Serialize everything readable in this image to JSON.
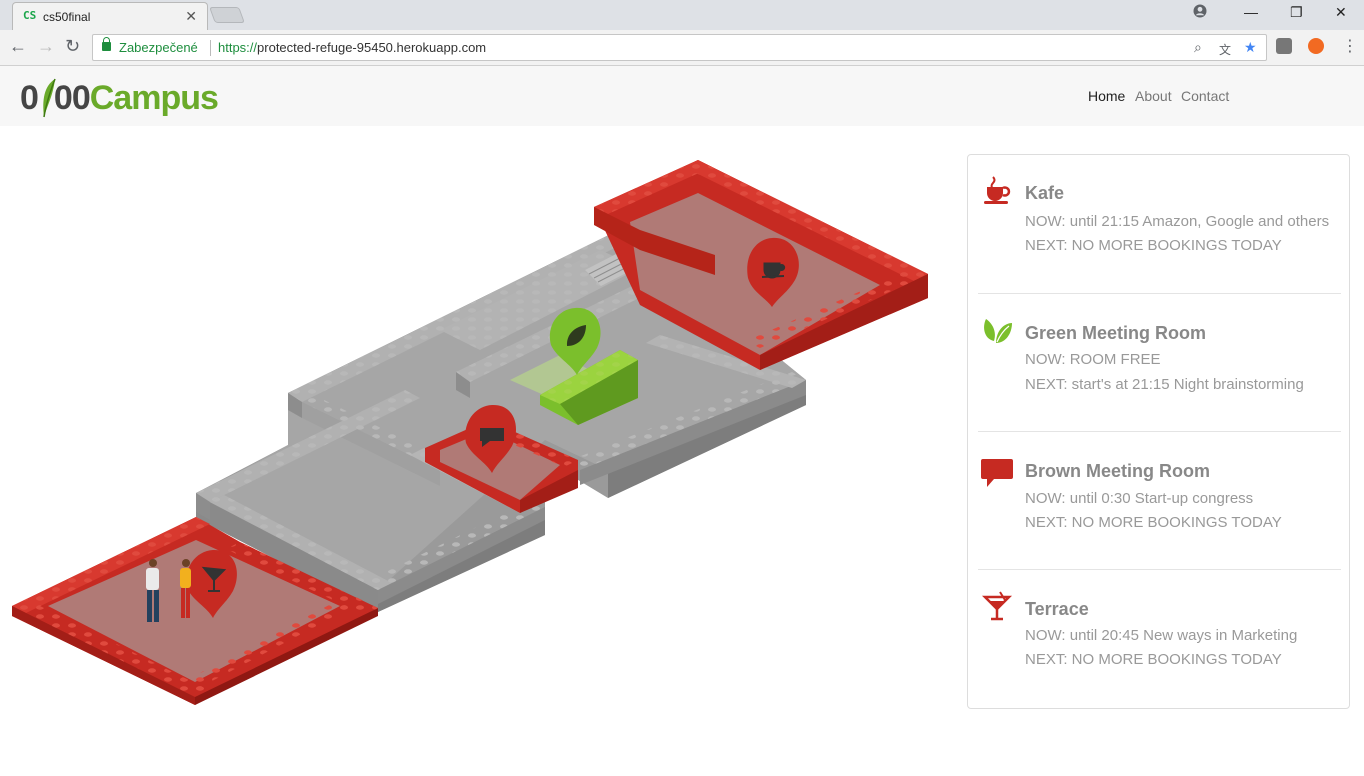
{
  "browser": {
    "tab_title": "cs50final",
    "tab_favicon": "CS",
    "secure_label": "Zabezpečené",
    "url_scheme": "https://",
    "url_rest": "protected-refuge-95450.herokuapp.com"
  },
  "site": {
    "logo_part1": "0",
    "logo_part2": "00",
    "logo_part3": "Campus",
    "nav": [
      "Home",
      "About",
      "Contact"
    ],
    "accent_green": "#6aaa2a",
    "accent_red": "#c62a22"
  },
  "rooms": [
    {
      "icon": "coffee-cup-icon",
      "name": "Kafe",
      "now": "NOW: until 21:15 Amazon, Google and others",
      "next": "NEXT: NO MORE BOOKINGS TODAY",
      "color": "#c62a22"
    },
    {
      "icon": "leaf-icon",
      "name": "Green Meeting Room",
      "now": "NOW: ROOM FREE",
      "next": "NEXT: start's at 21:15 Night brainstorming",
      "color": "#7bbf2c"
    },
    {
      "icon": "speech-bubble-icon",
      "name": "Brown Meeting Room",
      "now": "NOW: until 0:30 Start-up congress",
      "next": "NEXT: NO MORE BOOKINGS TODAY",
      "color": "#c62a22"
    },
    {
      "icon": "cocktail-glass-icon",
      "name": "Terrace",
      "now": "NOW: until 20:45 New ways in Marketing",
      "next": "NEXT: NO MORE BOOKINGS TODAY",
      "color": "#c62a22"
    }
  ]
}
